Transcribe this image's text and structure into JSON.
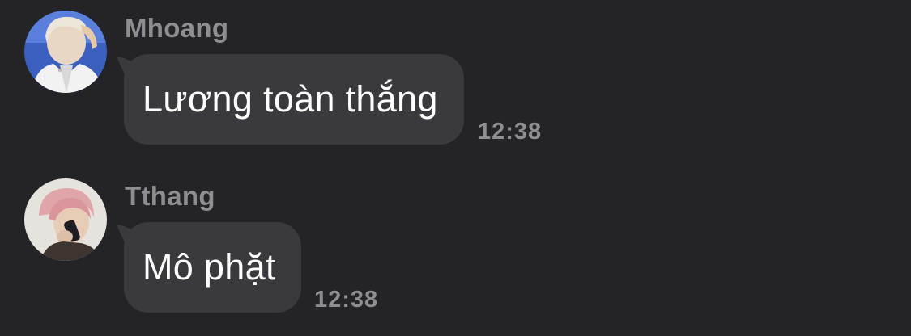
{
  "messages": [
    {
      "sender": "Mhoang",
      "text": "Lương toàn thắng",
      "time": "12:38"
    },
    {
      "sender": "Tthang",
      "text": "Mô phặt",
      "time": "12:38"
    }
  ],
  "colors": {
    "background": "#242327",
    "bubble": "#3a393d",
    "secondary_text": "#8e8d92",
    "primary_text": "#ffffff"
  }
}
